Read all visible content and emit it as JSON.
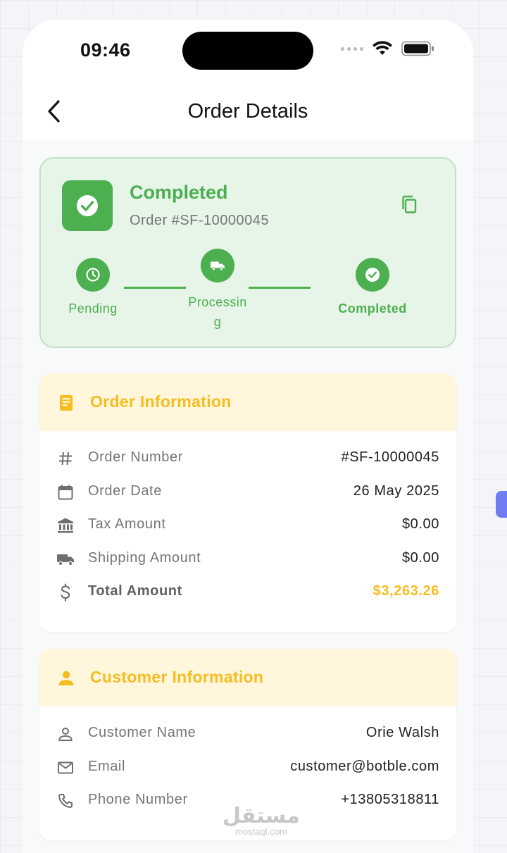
{
  "status_bar": {
    "time": "09:46"
  },
  "header": {
    "title": "Order Details"
  },
  "order_status": {
    "title": "Completed",
    "order_number": "Order #SF-10000045",
    "steps": [
      {
        "label": "Pending"
      },
      {
        "label": "Processin\ng"
      },
      {
        "label": "Completed"
      }
    ],
    "accent_color": "#4caf50"
  },
  "order_info": {
    "title": "Order Information",
    "rows": [
      {
        "label": "Order Number",
        "value": "#SF-10000045",
        "icon": "hash-icon"
      },
      {
        "label": "Order Date",
        "value": "26 May 2025",
        "icon": "calendar-icon"
      },
      {
        "label": "Tax Amount",
        "value": "$0.00",
        "icon": "bank-icon"
      },
      {
        "label": "Shipping Amount",
        "value": "$0.00",
        "icon": "truck-icon"
      },
      {
        "label": "Total Amount",
        "value": "$3,263.26",
        "icon": "dollar-icon"
      }
    ],
    "accent_color": "#f5bd1f"
  },
  "customer_info": {
    "title": "Customer Information",
    "rows": [
      {
        "label": "Customer Name",
        "value": "Orie Walsh",
        "icon": "person-icon"
      },
      {
        "label": "Email",
        "value": "customer@botble.com",
        "icon": "mail-icon"
      },
      {
        "label": "Phone Number",
        "value": "+13805318811",
        "icon": "phone-icon"
      }
    ]
  },
  "watermark": {
    "arabic": "مستقل",
    "latin": "mostaql.com"
  }
}
